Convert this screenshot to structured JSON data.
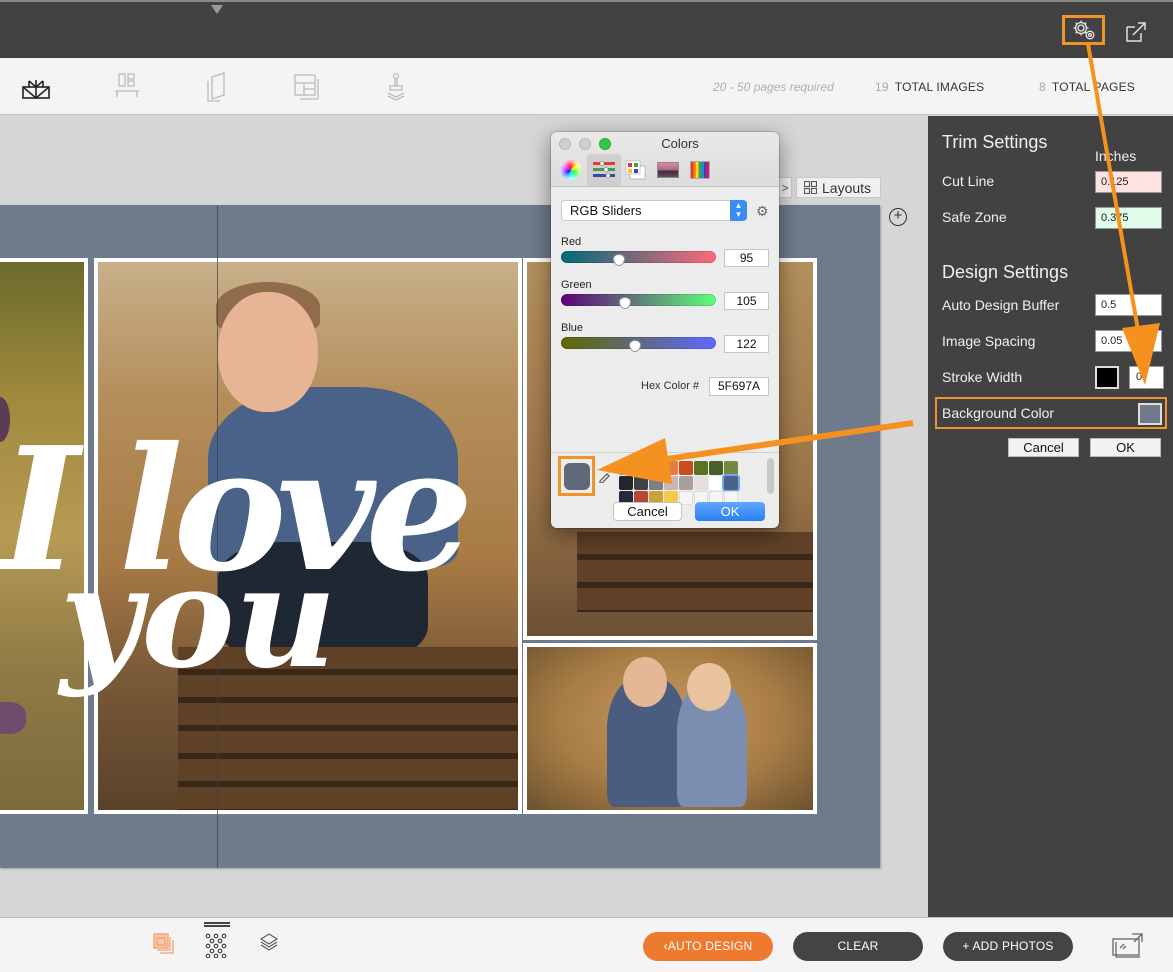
{
  "topbar": {
    "icons": [
      "dropdown-triangle-icon",
      "settings-gears-icon",
      "open-external-icon"
    ],
    "settings_highlight_color": "#f0932b"
  },
  "nav": {
    "icons": [
      "book-cover-icon",
      "layout-spread-icon",
      "pages-icon",
      "template-grid-icon",
      "stamp-icon"
    ],
    "pages_required": "20 - 50 pages required",
    "total_images_count": "19",
    "total_images_label": "TOTAL IMAGES",
    "total_pages_count": "8",
    "total_pages_label": "TOTAL PAGES"
  },
  "canvas": {
    "layouts_label": "Layouts",
    "page_background": "#6f7a8c",
    "overlay_text_line1": "I love",
    "overlay_text_line2": "you"
  },
  "trim_settings": {
    "title": "Trim Settings",
    "units": "Inches",
    "cut_line_label": "Cut Line",
    "cut_line_value": "0.125",
    "safe_zone_label": "Safe Zone",
    "safe_zone_value": "0.375"
  },
  "design_settings": {
    "title": "Design Settings",
    "auto_design_buffer_label": "Auto Design Buffer",
    "auto_design_buffer_value": "0.5",
    "image_spacing_label": "Image Spacing",
    "image_spacing_value": "0.05",
    "stroke_width_label": "Stroke Width",
    "stroke_color": "#000000",
    "stroke_width_value": "0",
    "background_color_label": "Background Color",
    "background_color": "#6f7a8c",
    "cancel_label": "Cancel",
    "ok_label": "OK"
  },
  "color_dialog": {
    "title": "Colors",
    "tabs": [
      "color-wheel",
      "color-sliders",
      "color-palettes",
      "image-palettes",
      "crayons"
    ],
    "selected_tab": "color-sliders",
    "mode": "RGB Sliders",
    "red_label": "Red",
    "red_value": "95",
    "green_label": "Green",
    "green_value": "105",
    "blue_label": "Blue",
    "blue_value": "122",
    "hex_label": "Hex Color #",
    "hex_value": "5F697A",
    "current_color": "#5f697a",
    "palette": [
      "#5f8ea6",
      "#6aa8c0",
      "#e0621f",
      "#e57c44",
      "#cc4b1e",
      "#5a7327",
      "#48612a",
      "#718a40",
      "#23272b",
      "#3f4247",
      "#7e7f81",
      "#c5b7b4",
      "#a8a09c",
      "#e5dedb",
      "#ffffff",
      "#4a6285",
      "#232a3c",
      "#b44930",
      "#c9a03b",
      "#f3c94a",
      "#f5f5f5",
      "#f5f5f5",
      "#f5f5f5",
      "#f5f5f5"
    ],
    "cancel_label": "Cancel",
    "ok_label": "OK"
  },
  "bottom": {
    "icons": [
      "photos-stack-icon",
      "pattern-grid-icon",
      "layers-icon",
      "fullscreen-preview-icon"
    ],
    "auto_design_label": "AUTO DESIGN",
    "clear_label": "CLEAR",
    "add_photos_label": "+ ADD PHOTOS",
    "accent_color": "#ee7a30",
    "dark_button_color": "#444444"
  }
}
